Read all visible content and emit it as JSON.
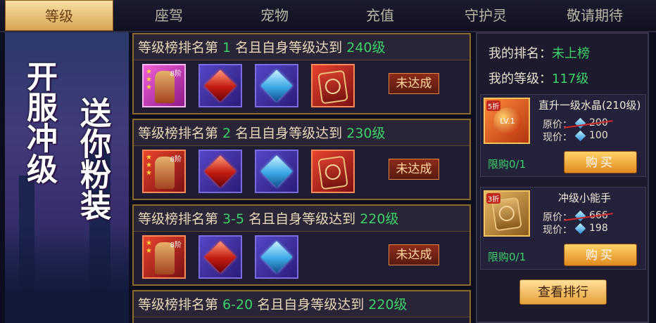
{
  "tabs": [
    "等级",
    "座驾",
    "宠物",
    "充值",
    "守护灵",
    "敬请期待"
  ],
  "banner": {
    "line1": "开服冲级",
    "line2": "送你粉装"
  },
  "ranks": [
    {
      "prefix": "等级榜排名第 ",
      "rank": "1",
      "mid": " 名且自身等级达到 ",
      "level": "240级",
      "status": "未达成",
      "tier": "8阶"
    },
    {
      "prefix": "等级榜排名第 ",
      "rank": "2",
      "mid": " 名且自身等级达到 ",
      "level": "230级",
      "status": "未达成",
      "tier": "8阶"
    },
    {
      "prefix": "等级榜排名第 ",
      "rank": "3-5",
      "mid": " 名且自身等级达到 ",
      "level": "220级",
      "status": "未达成",
      "tier": "8阶"
    },
    {
      "prefix": "等级榜排名第 ",
      "rank": "6-20",
      "mid": " 名且自身等级达到 ",
      "level": "220级"
    }
  ],
  "my": {
    "rank_label": "我的排名：",
    "rank_value": "未上榜",
    "level_label": "我的等级：",
    "level_value": "117级"
  },
  "shop": [
    {
      "name": "直升一级水晶(210级)",
      "discount": "5折",
      "icon_text": "LV.1",
      "orig_label": "原价：",
      "orig_price": "200",
      "now_label": "现价：",
      "now_price": "100",
      "limit": "限购0/1",
      "buy": "购买"
    },
    {
      "name": "冲级小能手",
      "discount": "3折",
      "orig_label": "原价：",
      "orig_price": "666",
      "now_label": "现价：",
      "now_price": "198",
      "limit": "限购0/1",
      "buy": "购买"
    }
  ],
  "view_rank": "查看排行"
}
